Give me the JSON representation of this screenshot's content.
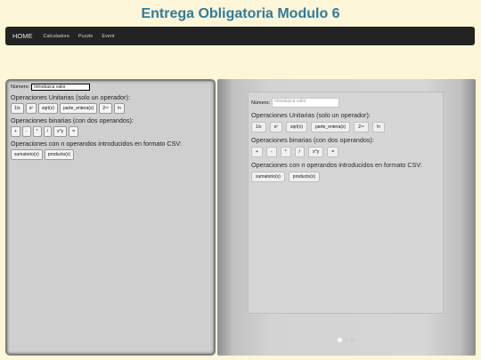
{
  "page": {
    "title": "Entrega Obligatoria Modulo 6"
  },
  "nav": {
    "items": [
      {
        "label": "HOME"
      },
      {
        "label": "Calculadora"
      },
      {
        "label": "Puzzle"
      },
      {
        "label": "Event"
      }
    ]
  },
  "calc": {
    "numero_label": "Número:",
    "numero_placeholder": "Introduzca valor",
    "unarias_title": "Operaciones Unitarias (solo un operador):",
    "unarias_buttons": [
      "1/x",
      "x²",
      "sqrt(x)",
      "parte_entera(x)",
      "2ⁿᵒ",
      "!n"
    ],
    "binarias_title": "Operaciones binarias (con dos operandos):",
    "binarias_buttons": [
      "+",
      "-",
      "*",
      "/",
      "x^y",
      "="
    ],
    "csv_title": "Operaciones con n operandos introducidos en formato CSV:",
    "csv_buttons": [
      "sumatorio(x)",
      "producto(x)"
    ]
  },
  "carousel": {
    "numero_label": "Número:",
    "numero_placeholder": "Introduzca valor",
    "unarias_title": "Operaciones Unitarias (solo un operador):",
    "unarias_buttons": [
      "1/x",
      "x²",
      "sqrt(x)",
      "parte_entera(x)",
      "2ⁿᵒ",
      "!n"
    ],
    "binarias_title": "Operaciones binarias (con dos operandos):",
    "binarias_buttons": [
      "+",
      "-",
      "*",
      "/",
      "x^y",
      "="
    ],
    "csv_title": "Operaciones con n operandos introducidos en formato CSV:",
    "csv_buttons": [
      "sumatorio(x)",
      "producto(x)"
    ],
    "prev_arrow": "‹",
    "next_arrow": "›",
    "slide_count": 3,
    "active_slide": 1
  }
}
